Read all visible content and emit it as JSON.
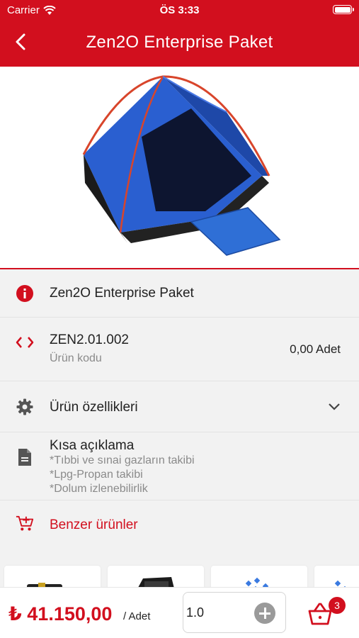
{
  "status_bar": {
    "carrier": "Carrier",
    "time": "ÖS 3:33"
  },
  "header": {
    "title": "Zen2O Enterprise Paket"
  },
  "product": {
    "name": "Zen2O Enterprise Paket",
    "code": "ZEN2.01.002",
    "code_label": "Ürün kodu",
    "stock": "0,00 Adet",
    "features_label": "Ürün özellikleri",
    "description_title": "Kısa açıklama",
    "description_lines": [
      "*Tıbbi ve sınai gazların takibi",
      "*Lpg-Propan takibi",
      "*Dolum izlenebilirlik"
    ],
    "similar_label": "Benzer ürünler"
  },
  "bottom_bar": {
    "price": "₺ 41.150,00",
    "price_unit": "/ Adet",
    "quantity_value": "1.0",
    "cart_count": "3"
  },
  "colors": {
    "brand_red": "#d20f1e",
    "background": "#f2f2f2",
    "muted_text": "#8a8a8a"
  },
  "icons": [
    "wifi-icon",
    "battery-icon",
    "back-arrow-icon",
    "info-icon",
    "code-icon",
    "gear-icon",
    "chevron-down-icon",
    "document-icon",
    "cart-add-icon",
    "plus-icon",
    "basket-icon"
  ]
}
